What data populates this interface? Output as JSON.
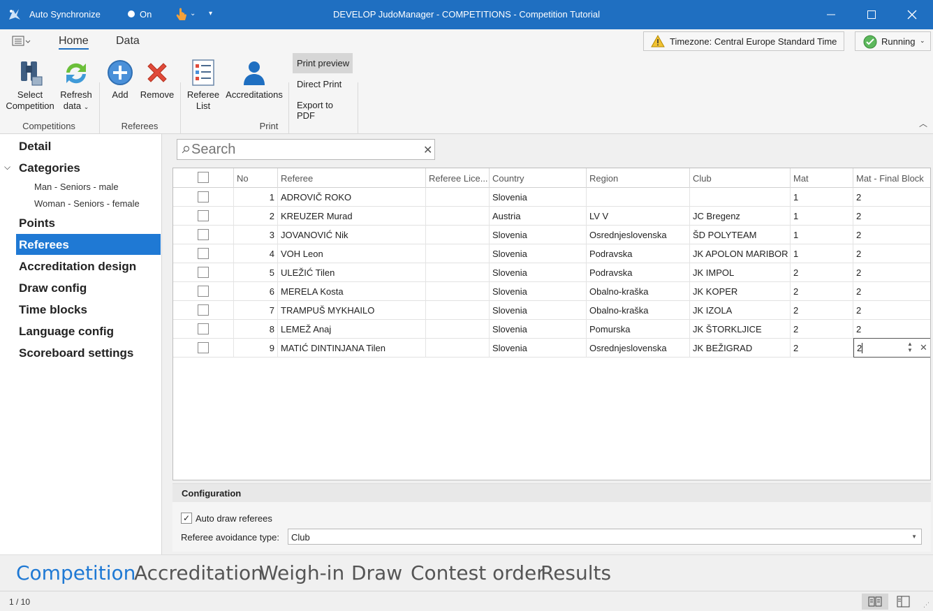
{
  "titlebar": {
    "sync_label": "Auto Synchronize",
    "toggle_label": "On",
    "window_title": "DEVELOP JudoManager - COMPETITIONS - Competition Tutorial"
  },
  "ribbon": {
    "tabs": {
      "home": "Home",
      "data": "Data"
    },
    "timezone": "Timezone: Central Europe Standard Time",
    "status": "Running",
    "buttons": {
      "select_competition": "Select\nCompetition",
      "select_competition_l1": "Select",
      "select_competition_l2": "Competition",
      "refresh_l1": "Refresh",
      "refresh_l2": "data",
      "add": "Add",
      "remove": "Remove",
      "referee_list_l1": "Referee",
      "referee_list_l2": "List",
      "accreditations": "Accreditations",
      "print_preview": "Print preview",
      "direct_print": "Direct Print",
      "export_pdf": "Export to PDF"
    },
    "groups": {
      "competitions": "Competitions",
      "referees": "Referees",
      "print": "Print"
    }
  },
  "leftnav": {
    "detail": "Detail",
    "categories": "Categories",
    "category_items": [
      "Man - Seniors - male",
      "Woman - Seniors - female"
    ],
    "points": "Points",
    "referees": "Referees",
    "accreditation_design": "Accreditation design",
    "draw_config": "Draw config",
    "time_blocks": "Time blocks",
    "language_config": "Language config",
    "scoreboard_settings": "Scoreboard settings"
  },
  "search": {
    "placeholder": "Search"
  },
  "grid": {
    "columns": [
      "No",
      "Referee",
      "Referee Lice...",
      "Country",
      "Region",
      "Club",
      "Mat",
      "Mat - Final Block"
    ],
    "rows": [
      {
        "no": "1",
        "referee": "ADROVIČ ROKO",
        "license": "",
        "country": "Slovenia",
        "region": "",
        "club": "",
        "mat": "1",
        "final": "2"
      },
      {
        "no": "2",
        "referee": "KREUZER Murad",
        "license": "",
        "country": "Austria",
        "region": "LV V",
        "club": "JC Bregenz",
        "mat": "1",
        "final": "2"
      },
      {
        "no": "3",
        "referee": "JOVANOVIĆ Nik",
        "license": "",
        "country": "Slovenia",
        "region": "Osrednjeslovenska",
        "club": "ŠD POLYTEAM",
        "mat": "1",
        "final": "2"
      },
      {
        "no": "4",
        "referee": "VOH Leon",
        "license": "",
        "country": "Slovenia",
        "region": "Podravska",
        "club": "JK APOLON MARIBOR",
        "mat": "1",
        "final": "2"
      },
      {
        "no": "5",
        "referee": "ULEŽIĆ Tilen",
        "license": "",
        "country": "Slovenia",
        "region": "Podravska",
        "club": "JK IMPOL",
        "mat": "2",
        "final": "2"
      },
      {
        "no": "6",
        "referee": "MERELA Kosta",
        "license": "",
        "country": "Slovenia",
        "region": "Obalno-kraška",
        "club": "JK KOPER",
        "mat": "2",
        "final": "2"
      },
      {
        "no": "7",
        "referee": "TRAMPUŠ MYKHAILO",
        "license": "",
        "country": "Slovenia",
        "region": "Obalno-kraška",
        "club": "JK IZOLA",
        "mat": "2",
        "final": "2"
      },
      {
        "no": "8",
        "referee": "LEMEŽ Anaj",
        "license": "",
        "country": "Slovenia",
        "region": "Pomurska",
        "club": "JK ŠTORKLJICE",
        "mat": "2",
        "final": "2"
      },
      {
        "no": "9",
        "referee": "MATIĆ DINTINJANA Tilen",
        "license": "",
        "country": "Slovenia",
        "region": "Osrednjeslovenska",
        "club": "JK BEŽIGRAD",
        "mat": "2",
        "final": "2"
      }
    ]
  },
  "config": {
    "header": "Configuration",
    "auto_draw_label": "Auto draw referees",
    "auto_draw_checked": true,
    "avoidance_label": "Referee avoidance type:",
    "avoidance_value": "Club"
  },
  "bottomnav": [
    "Competition",
    "Accreditation",
    "Weigh-in",
    "Draw",
    "Contest order",
    "Results"
  ],
  "status": {
    "page": "1 / 10"
  },
  "colors": {
    "accent": "#1f79d4",
    "titlebar": "#1f6fc1"
  }
}
